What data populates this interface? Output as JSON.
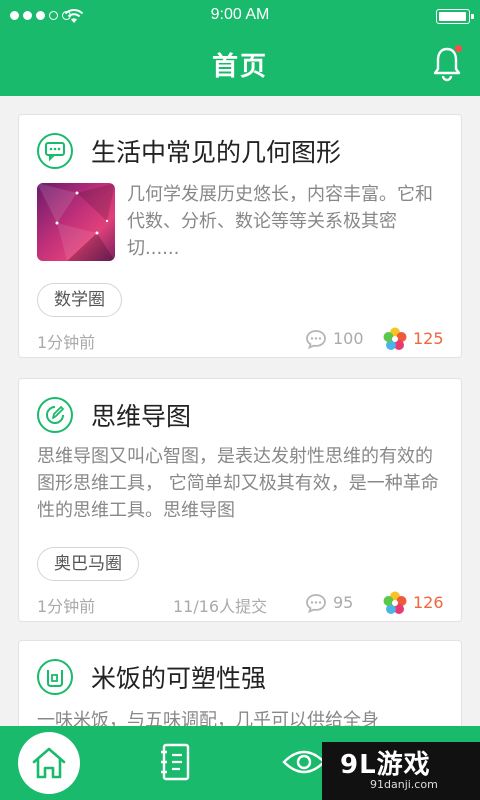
{
  "status_bar": {
    "time": "9:00 AM"
  },
  "nav": {
    "title": "首页"
  },
  "cards": [
    {
      "title": "生活中常见的几何图形",
      "body": "几何学发展历史悠长，内容丰富。它和代数、分析、数论等等关系极其密切......",
      "tag": "数学圈",
      "time": "1分钟前",
      "comments": "100",
      "likes": "125"
    },
    {
      "title": "思维导图",
      "body": "思维导图又叫心智图，是表达发射性思维的有效的图形思维工具， 它简单却又极其有效，是一种革命性的思维工具。思维导图",
      "tag": "奥巴马圈",
      "time": "1分钟前",
      "submitted": "11/16人提交",
      "comments": "95",
      "likes": "126"
    },
    {
      "title": "米饭的可塑性强",
      "body": "一味米饭，与五味调配，几乎可以供给全身"
    }
  ],
  "tab_bar": {
    "items": [
      "home",
      "notes",
      "eye"
    ]
  },
  "watermark": {
    "logo": "9L游戏",
    "site": "91danji.com"
  },
  "colors": {
    "primary": "#1aba6c",
    "like": "#f0653b",
    "badge": "#ff4b4b"
  }
}
